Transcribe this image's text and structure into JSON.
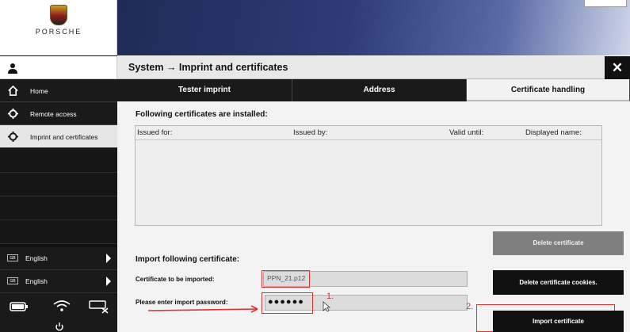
{
  "brand": {
    "name": "PORSCHE"
  },
  "header": {
    "title": "System → Imprint and certificates",
    "close": "✕"
  },
  "sidebar": {
    "items": [
      {
        "label": "Home",
        "icon": "home-icon"
      },
      {
        "label": "Remote access",
        "icon": "gear-icon"
      },
      {
        "label": "Imprint and certificates",
        "icon": "gear-icon"
      }
    ],
    "languages": [
      {
        "flag": "GB",
        "label": "English"
      },
      {
        "flag": "GB",
        "label": "English"
      }
    ]
  },
  "tabs": [
    {
      "label": "Tester imprint"
    },
    {
      "label": "Address"
    },
    {
      "label": "Certificate handling"
    }
  ],
  "certs": {
    "heading": "Following certificates are installed:",
    "columns": [
      "Issued for:",
      "Issued by:",
      "Valid until:",
      "Displayed name:"
    ],
    "delete_button": "Delete certificate",
    "delete_cookies_button": "Delete certificate cookies."
  },
  "import": {
    "heading": "Import following certificate:",
    "file_label": "Certificate to be imported:",
    "file_value": "PPN_21.p12",
    "password_label": "Please enter import password:",
    "password_value": "●●●●●●",
    "import_button": "Import certificate"
  },
  "annotations": {
    "step1": "1.",
    "step2": "2."
  },
  "colors": {
    "accent_red": "#e03030",
    "dark": "#111111",
    "gray_button": "#7f7f7f"
  }
}
